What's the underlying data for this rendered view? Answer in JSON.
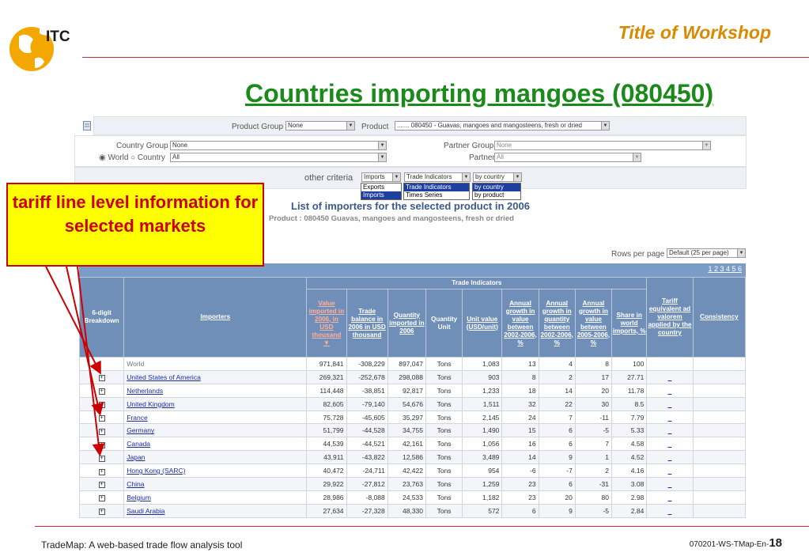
{
  "header": {
    "logo_text": "ITC",
    "slide_title": "Title of Workshop",
    "heading": "Countries importing mangoes (080450)"
  },
  "panel": {
    "product_group_label": "Product Group",
    "product_group_value": "None",
    "product_label": "Product",
    "product_value": "....... 080450 - Guavas, mangoes and mangosteens, fresh or dried",
    "country_group_label": "Country Group",
    "country_group_value": "None",
    "world_label": "World",
    "country_label": "Country",
    "country_value": "All",
    "partner_group_label": "Partner Group",
    "partner_group_value": "None",
    "partner_label": "Partner",
    "partner_value": "All",
    "other_criteria_label": "other criteria",
    "flow_value": "Imports",
    "flow_options": [
      "Exports",
      "Imports"
    ],
    "indicator_value": "Trade Indicators",
    "indicator_options": [
      "Trade Indicators",
      "Times Series"
    ],
    "by_value": "by country",
    "by_options": [
      "by country",
      "by product"
    ]
  },
  "list": {
    "title": "List of importers for the selected product in 2006",
    "subtitle": "Product : 080450 Guavas, mangoes and mangosteens, fresh or dried",
    "rows_label": "Rows per page",
    "rows_value": "Default (25 per page)",
    "pages": "1 2 3 4 5 6"
  },
  "table": {
    "group_header": "Trade Indicators",
    "headers": {
      "breakdown": "6-digit Breakdown",
      "importers": "Importers",
      "value": "Value imported in 2006, in USD thousand",
      "balance": "Trade balance in 2006 in USD thousand",
      "quantity": "Quantity imported in 2006",
      "qunit": "Quantity Unit",
      "unitval": "Unit value (USD/unit)",
      "gval": "Annual growth in value between 2002-2006, %",
      "gqty": "Annual growth in quantity between 2002-2006, %",
      "gval2": "Annual growth in value between 2005-2006, %",
      "share": "Share in world imports, %",
      "tariff": "Tariff equivalent ad valorem applied by the country",
      "consistency": "Consistency"
    },
    "rows": [
      {
        "name": "World",
        "value": "971,841",
        "balance": "-308,229",
        "qty": "897,047",
        "unit": "Tons",
        "uv": "1,083",
        "g1": "13",
        "g2": "4",
        "g3": "8",
        "share": "100",
        "tariff": "",
        "world": true
      },
      {
        "name": "United States of America",
        "value": "269,321",
        "balance": "-252,678",
        "qty": "298,088",
        "unit": "Tons",
        "uv": "903",
        "g1": "8",
        "g2": "2",
        "g3": "17",
        "share": "27.71",
        "tariff": "_"
      },
      {
        "name": "Netherlands",
        "value": "114,448",
        "balance": "-38,851",
        "qty": "92,817",
        "unit": "Tons",
        "uv": "1,233",
        "g1": "18",
        "g2": "14",
        "g3": "20",
        "share": "11.78",
        "tariff": "_"
      },
      {
        "name": "United Kingdom",
        "value": "82,605",
        "balance": "-79,140",
        "qty": "54,676",
        "unit": "Tons",
        "uv": "1,511",
        "g1": "32",
        "g2": "22",
        "g3": "30",
        "share": "8.5",
        "tariff": "_"
      },
      {
        "name": "France",
        "value": "75,728",
        "balance": "-45,605",
        "qty": "35,297",
        "unit": "Tons",
        "uv": "2,145",
        "g1": "24",
        "g2": "7",
        "g3": "-11",
        "share": "7.79",
        "tariff": "_"
      },
      {
        "name": "Germany",
        "value": "51,799",
        "balance": "-44,528",
        "qty": "34,755",
        "unit": "Tons",
        "uv": "1,490",
        "g1": "15",
        "g2": "6",
        "g3": "-5",
        "share": "5.33",
        "tariff": "_"
      },
      {
        "name": "Canada",
        "value": "44,539",
        "balance": "-44,521",
        "qty": "42,161",
        "unit": "Tons",
        "uv": "1,056",
        "g1": "16",
        "g2": "6",
        "g3": "7",
        "share": "4.58",
        "tariff": "_"
      },
      {
        "name": "Japan",
        "value": "43,911",
        "balance": "-43,822",
        "qty": "12,586",
        "unit": "Tons",
        "uv": "3,489",
        "g1": "14",
        "g2": "9",
        "g3": "1",
        "share": "4.52",
        "tariff": "_"
      },
      {
        "name": "Hong Kong (SARC)",
        "value": "40,472",
        "balance": "-24,711",
        "qty": "42,422",
        "unit": "Tons",
        "uv": "954",
        "g1": "-6",
        "g2": "-7",
        "g3": "2",
        "share": "4.16",
        "tariff": "_"
      },
      {
        "name": "China",
        "value": "29,922",
        "balance": "-27,812",
        "qty": "23,763",
        "unit": "Tons",
        "uv": "1,259",
        "g1": "23",
        "g2": "6",
        "g3": "-31",
        "share": "3.08",
        "tariff": "_"
      },
      {
        "name": "Belgium",
        "value": "28,986",
        "balance": "-8,088",
        "qty": "24,533",
        "unit": "Tons",
        "uv": "1,182",
        "g1": "23",
        "g2": "20",
        "g3": "80",
        "share": "2.98",
        "tariff": "_"
      },
      {
        "name": "Saudi Arabia",
        "value": "27,634",
        "balance": "-27,328",
        "qty": "48,330",
        "unit": "Tons",
        "uv": "572",
        "g1": "6",
        "g2": "9",
        "g3": "-5",
        "share": "2.84",
        "tariff": "_"
      }
    ]
  },
  "callout": {
    "text": "tariff line level information for selected markets"
  },
  "footer": {
    "left": "TradeMap: A web-based trade flow analysis tool",
    "code": "070201-WS-TMap-En-",
    "page": "18"
  },
  "colors": {
    "heading": "#1a8a1a",
    "slide_title": "#d98a00",
    "callout_bg": "#ffff00",
    "callout_text": "#cc0000",
    "table_header": "#6f8fb8"
  }
}
